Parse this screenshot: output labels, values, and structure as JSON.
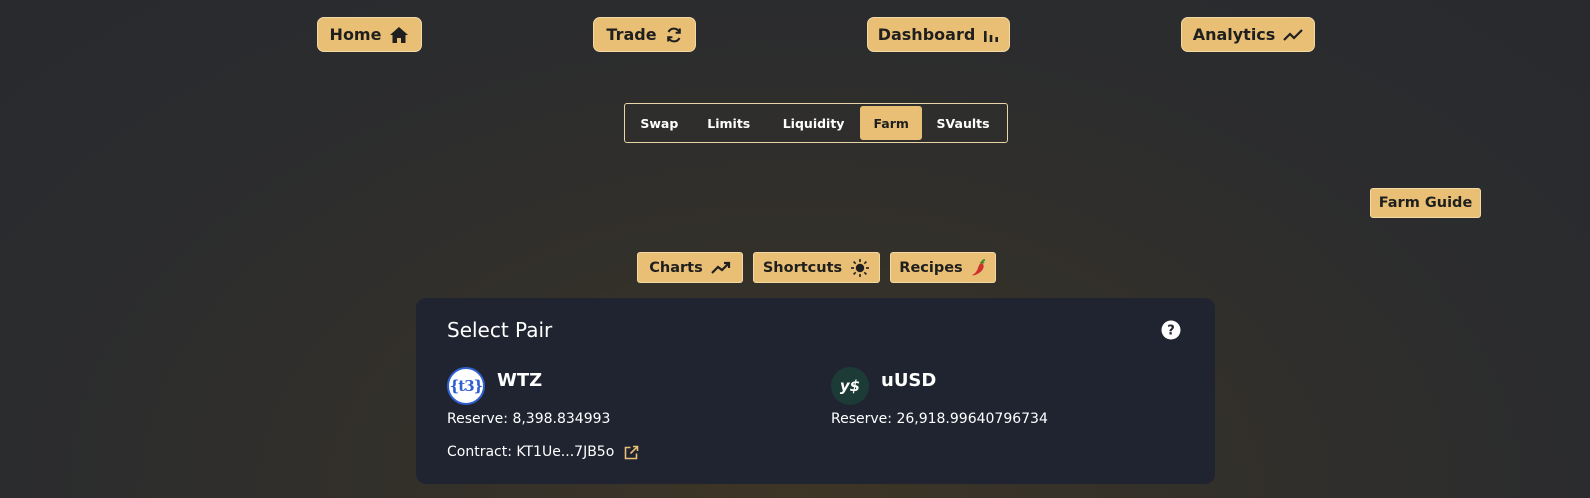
{
  "nav": {
    "home": "Home",
    "trade": "Trade",
    "dashboard": "Dashboard",
    "analytics": "Analytics"
  },
  "tabs": [
    "Swap",
    "Limits",
    "Liquidity",
    "Farm",
    "SVaults"
  ],
  "active_tab": "Farm",
  "farm_guide": "Farm Guide",
  "tools": {
    "charts": "Charts",
    "shortcuts": "Shortcuts",
    "recipes": "Recipes"
  },
  "pair": {
    "title": "Select Pair",
    "token_a": {
      "symbol": "WTZ",
      "reserve": "Reserve: 8,398.834993",
      "logo_text": "{t3}"
    },
    "token_b": {
      "symbol": "uUSD",
      "reserve": "Reserve: 26,918.99640796734",
      "logo_text": "y$"
    },
    "contract": "Contract: KT1Ue...7JB5o"
  },
  "colors": {
    "accent": "#e8bf74",
    "card_bg": "#202431",
    "page_bg": "#2b2c2e"
  }
}
